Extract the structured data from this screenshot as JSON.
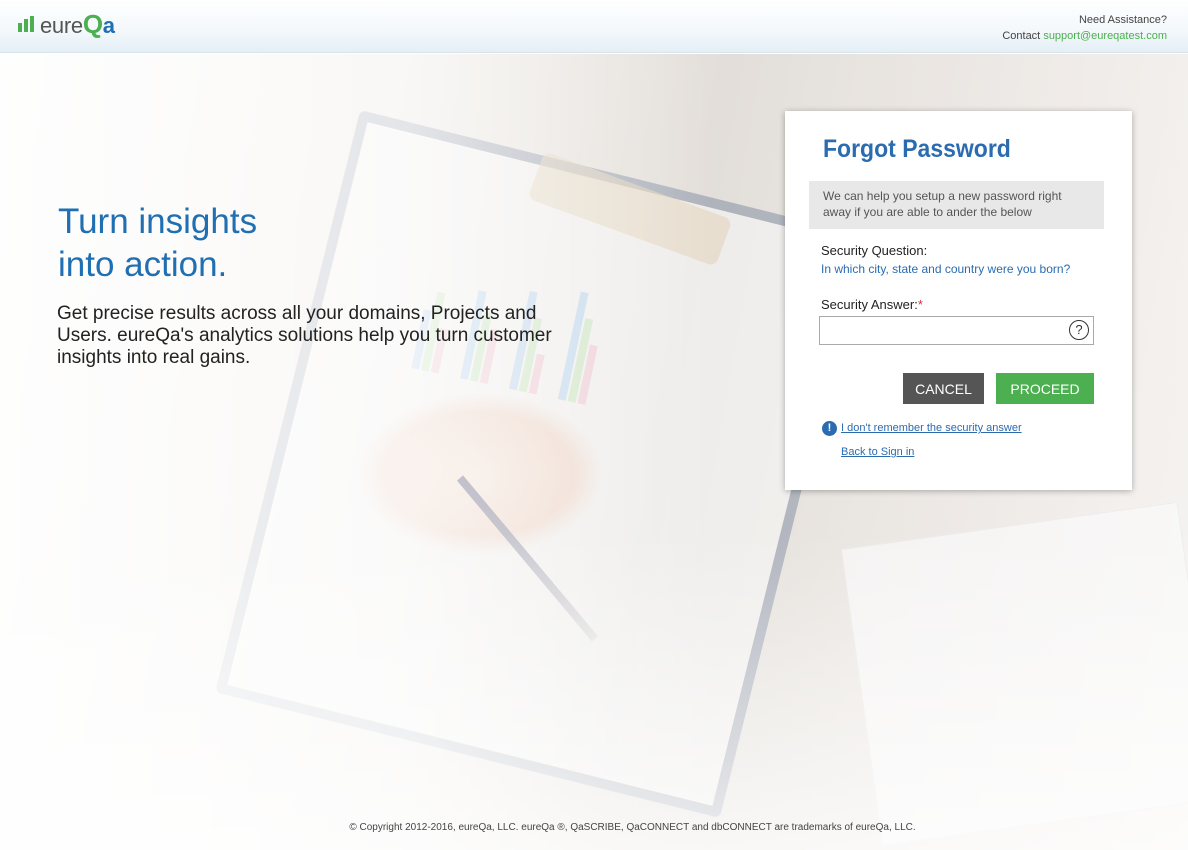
{
  "header": {
    "logo": {
      "prefix": "eure",
      "q": "Q",
      "a": "a"
    },
    "assist_title": "Need Assistance?",
    "contact_label": "Contact",
    "contact_email": "support@eureqatest.com"
  },
  "hero": {
    "tagline_line1": "Turn insights",
    "tagline_line2": "into action.",
    "subtext": "Get precise results across all your domains, Projects and Users. eureQa's analytics solutions help you turn customer insights into real gains."
  },
  "forgot": {
    "title": "Forgot Password",
    "info": "We can help you setup a new password right away if you are able to ander the below",
    "question_label": "Security Question:",
    "question_text": "In which city, state and country were you born?",
    "answer_label": "Security Answer:",
    "required_mark": "*",
    "answer_value": "",
    "help_glyph": "?",
    "cancel_label": "CANCEL",
    "proceed_label": "PROCEED",
    "alert_glyph": "!",
    "forgot_answer_link": "I don't remember the security answer",
    "back_link": "Back to Sign in"
  },
  "footer": {
    "copyright": "© Copyright 2012-2016, eureQa, LLC. eureQa ®, QaSCRIBE, QaCONNECT and dbCONNECT are trademarks of eureQa, LLC."
  },
  "colors": {
    "brand_blue": "#2b6cb0",
    "brand_green": "#4caf50",
    "cancel_gray": "#555555"
  }
}
